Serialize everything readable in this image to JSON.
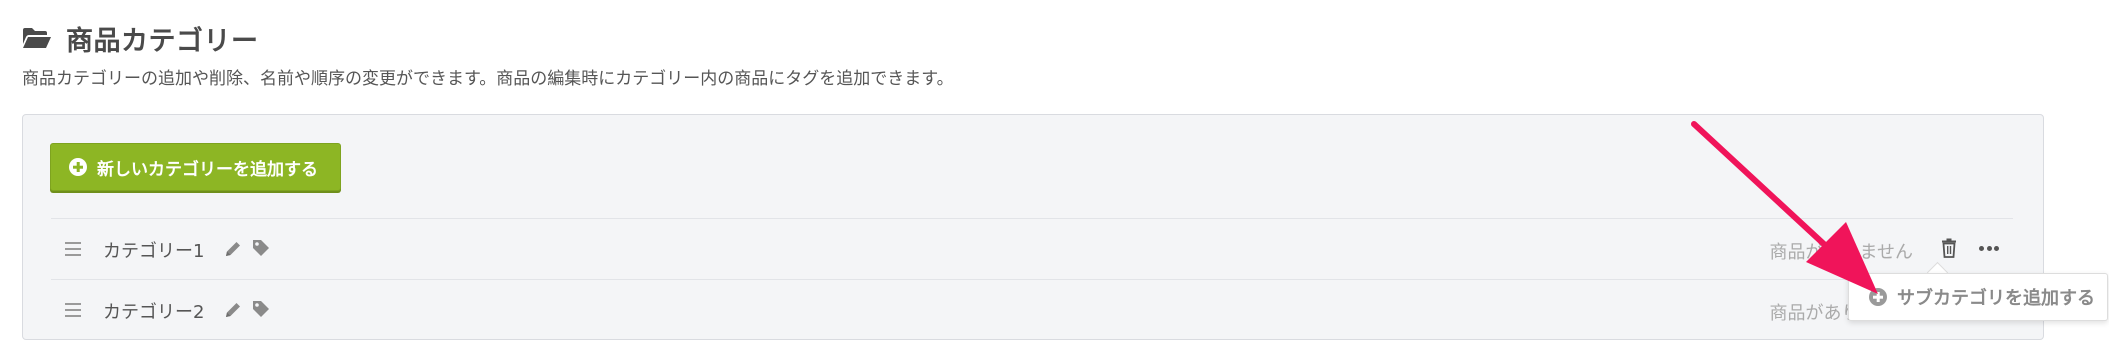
{
  "header": {
    "title": "商品カテゴリー",
    "icon": "folder-open-icon",
    "description": "商品カテゴリーの追加や削除、名前や順序の変更ができます。商品の編集時にカテゴリー内の商品にタグを追加できます。"
  },
  "toolbar": {
    "add_category_label": "新しいカテゴリーを追加する",
    "accent_color": "#8db624"
  },
  "categories": [
    {
      "name": "カテゴリー1",
      "status": "商品がありません"
    },
    {
      "name": "カテゴリー2",
      "status": "商品がありません"
    }
  ],
  "dropdown": {
    "add_subcategory_label": "サブカテゴリを追加する"
  },
  "annotation": {
    "arrow_color": "#f0145a"
  }
}
